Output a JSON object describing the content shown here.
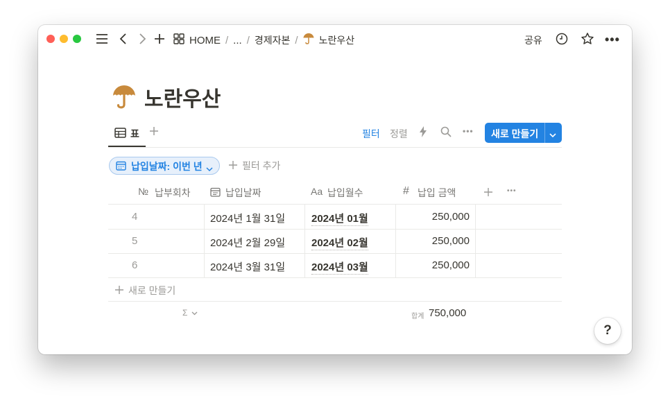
{
  "titlebar": {
    "back_icon": "chevron-left-icon",
    "forward_icon": "chevron-right-icon",
    "breadcrumb": [
      "HOME",
      "...",
      "경제자본",
      "노란우산"
    ],
    "share_label": "공유"
  },
  "page": {
    "icon": "umbrella-icon",
    "title": "노란우산"
  },
  "toolbar": {
    "view_tab_label": "표",
    "filter_label": "필터",
    "sort_label": "정렬",
    "new_button_label": "새로 만들기"
  },
  "filter": {
    "pill_label": "납입날짜: 이번 년",
    "add_filter_label": "필터 추가"
  },
  "table": {
    "columns": [
      {
        "icon": "№",
        "label": "납부회차"
      },
      {
        "icon": "calendar-icon",
        "label": "납입날짜"
      },
      {
        "icon": "Aa",
        "label": "납입월수"
      },
      {
        "icon": "#",
        "label": "납입 금액"
      }
    ],
    "rows": [
      {
        "no": "4",
        "date": "2024년 1월 31일",
        "month": "2024년 01월",
        "amount": "250,000"
      },
      {
        "no": "5",
        "date": "2024년 2월 29일",
        "month": "2024년 02월",
        "amount": "250,000"
      },
      {
        "no": "6",
        "date": "2024년 3월 31일",
        "month": "2024년 03월",
        "amount": "250,000"
      }
    ],
    "new_row_label": "새로 만들기",
    "footer": {
      "sigma": "Σ",
      "sum_label": "합계",
      "sum_value": "750,000"
    }
  },
  "help_label": "?",
  "colors": {
    "accent": "#2383e2",
    "umbrella": "#c88a3c",
    "close": "#ff5f57",
    "minimize": "#febc2e",
    "zoom": "#28c840"
  }
}
